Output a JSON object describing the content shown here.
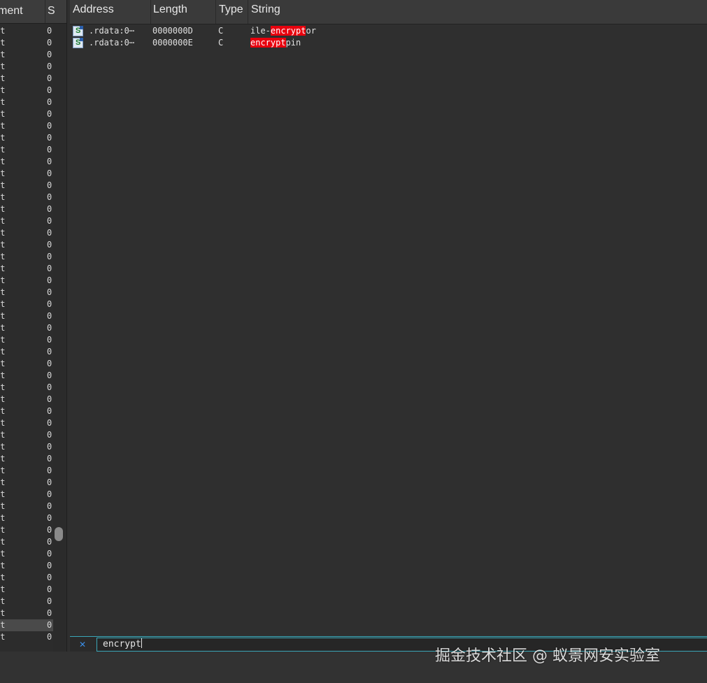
{
  "segments_pane": {
    "header_col1": "ment",
    "header_col2": "S",
    "row_name": "xt",
    "row_value": "0",
    "row_count": 52,
    "selected_row_index": 50
  },
  "strings_pane": {
    "columns": [
      "Address",
      "Length",
      "Type",
      "String"
    ],
    "rows": [
      {
        "address": ".rdata:0⋯",
        "length": "0000000D",
        "type": "C",
        "string_before": "ile-",
        "string_match": "encrypt",
        "string_after": "or",
        "icon": "string-s-icon"
      },
      {
        "address": ".rdata:0⋯",
        "length": "0000000E",
        "type": "C",
        "string_before": "",
        "string_match": "encrypt",
        "string_after": "pin",
        "icon": "string-s-icon"
      }
    ]
  },
  "filter": {
    "value": "encrypt",
    "close_icon": "close-icon"
  },
  "watermark": "掘金技术社区 @ 蚁景网安实验室",
  "colors": {
    "highlight": "#e8000e",
    "filter_border": "#3aa7b8",
    "background": "#2f2f2f"
  }
}
